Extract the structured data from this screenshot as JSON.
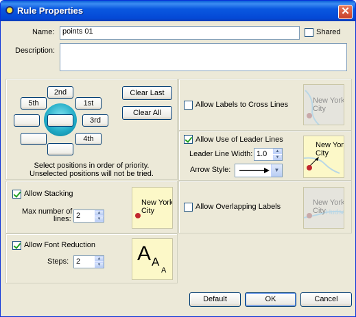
{
  "window": {
    "title": "Rule Properties",
    "close_label": "✕"
  },
  "name": {
    "label": "Name:",
    "value": "points 01",
    "shared_label": "Shared"
  },
  "description": {
    "label": "Description:",
    "value": ""
  },
  "positions": {
    "buttons": {
      "p2": "2nd",
      "p5": "5th",
      "p1": "1st",
      "p3": "3rd",
      "p4": "4th",
      "blank_left": "",
      "blank_center": "",
      "blank_bottom_left": "",
      "blank_bottom": ""
    },
    "clear_last": "Clear Last",
    "clear_all": "Clear All",
    "hint_line1": "Select positions in order of priority.",
    "hint_line2": "Unselected positions will not be tried."
  },
  "cross_lines": {
    "label": "Allow Labels to Cross Lines",
    "checked": false,
    "preview_text_1": "New York",
    "preview_text_2": "City"
  },
  "leader_lines": {
    "label": "Allow Use of Leader Lines",
    "checked": true,
    "width_label": "Leader Line Width:",
    "width_value": "1.0",
    "arrow_label": "Arrow Style:",
    "arrow_value": "→",
    "preview_text_1": "New York",
    "preview_text_2": "City"
  },
  "stacking": {
    "label": "Allow Stacking",
    "checked": true,
    "max_label_1": "Max number of",
    "max_label_2": "lines:",
    "max_value": "2",
    "preview_text_1": "New York",
    "preview_text_2": "City"
  },
  "overlapping": {
    "label": "Allow Overlapping Labels",
    "checked": false,
    "preview_text_1": "New York",
    "preview_text_2": "City",
    "preview_overlap": "Hudson"
  },
  "font_reduction": {
    "label": "Allow Font Reduction",
    "checked": true,
    "steps_label": "Steps:",
    "steps_value": "2",
    "preview_big": "A",
    "preview_mid": "A",
    "preview_small": "A"
  },
  "footer": {
    "default_label": "Default",
    "ok_label": "OK",
    "cancel_label": "Cancel"
  }
}
